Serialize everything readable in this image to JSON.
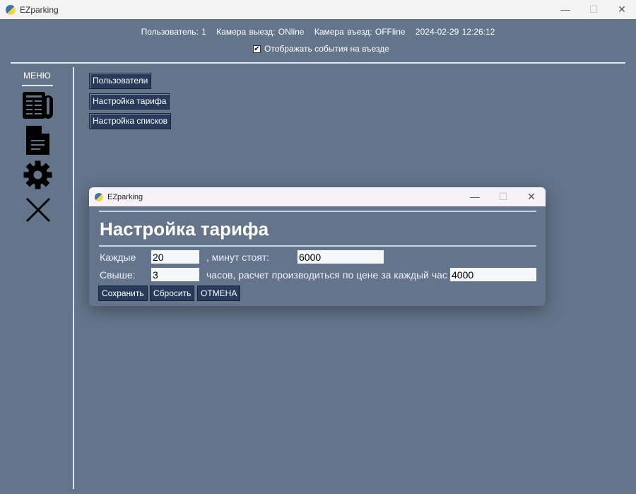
{
  "app": {
    "title": "EZparking",
    "minimize": "—",
    "maximize": "☐",
    "close": "✕"
  },
  "status": {
    "user": "Пользователь: 1",
    "exit_cam": "Камера выезд: ONline",
    "entry_cam": "Камера въезд: OFFline",
    "datetime": "2024-02-29 12:26:12"
  },
  "show_entry_events": {
    "label": "Отображать события на въезде",
    "checked": true,
    "mark": "✔"
  },
  "menu": {
    "title": "МЕНЮ",
    "icons": [
      "newspaper-icon",
      "document-icon",
      "gear-icon",
      "close-icon"
    ]
  },
  "nav": {
    "users": "Пользователи",
    "tariff": "Настройка тарифа",
    "lists": "Настройка списков"
  },
  "dialog": {
    "title": "EZparking",
    "minimize": "—",
    "maximize": "☐",
    "close": "✕",
    "heading": "Настройка тарифа",
    "every_label": "Каждые",
    "every_value": "20",
    "minutes_cost_label": ", минут стоят:",
    "minutes_cost_value": "6000",
    "over_label": "Свыше:",
    "over_value": "3",
    "hours_label": "часов, расчет производиться по цене за каждый час",
    "hour_price_value": "4000",
    "save": "Сохранить",
    "reset": "Сбросить",
    "cancel": "ОТМЕНА"
  }
}
